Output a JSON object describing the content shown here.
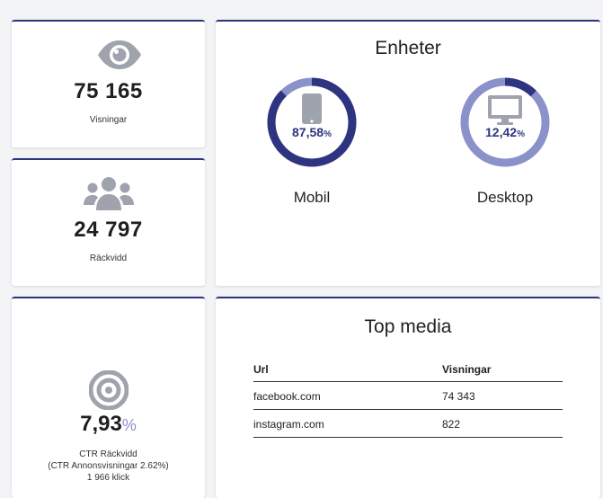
{
  "visningar": {
    "value": "75 165",
    "label": "Visningar",
    "icon": "eye-icon"
  },
  "rackvidd": {
    "value": "24 797",
    "label": "Räckvidd",
    "icon": "users-icon"
  },
  "enheter": {
    "title": "Enheter",
    "devices": [
      {
        "name": "Mobil",
        "percent_text": "87,58",
        "percent_unit": "%",
        "fraction": 0.8758,
        "icon": "mobile-icon"
      },
      {
        "name": "Desktop",
        "percent_text": "12,42",
        "percent_unit": "%",
        "fraction": 0.1242,
        "icon": "monitor-icon"
      }
    ],
    "colors": {
      "primary": "#2e3480",
      "secondary": "#8b91c9",
      "icon_gray": "#9ea3ad"
    }
  },
  "ctr": {
    "value": "7,93",
    "unit": "%",
    "label": "CTR Räckvidd",
    "sub_label": "(CTR Annonsvisningar 2.62%)",
    "clicks": "1 966 klick",
    "icon": "target-icon"
  },
  "top_media": {
    "title": "Top media",
    "columns": [
      "Url",
      "Visningar"
    ],
    "rows": [
      {
        "url": "facebook.com",
        "visningar": "74 343"
      },
      {
        "url": "instagram.com",
        "visningar": "822"
      }
    ]
  }
}
